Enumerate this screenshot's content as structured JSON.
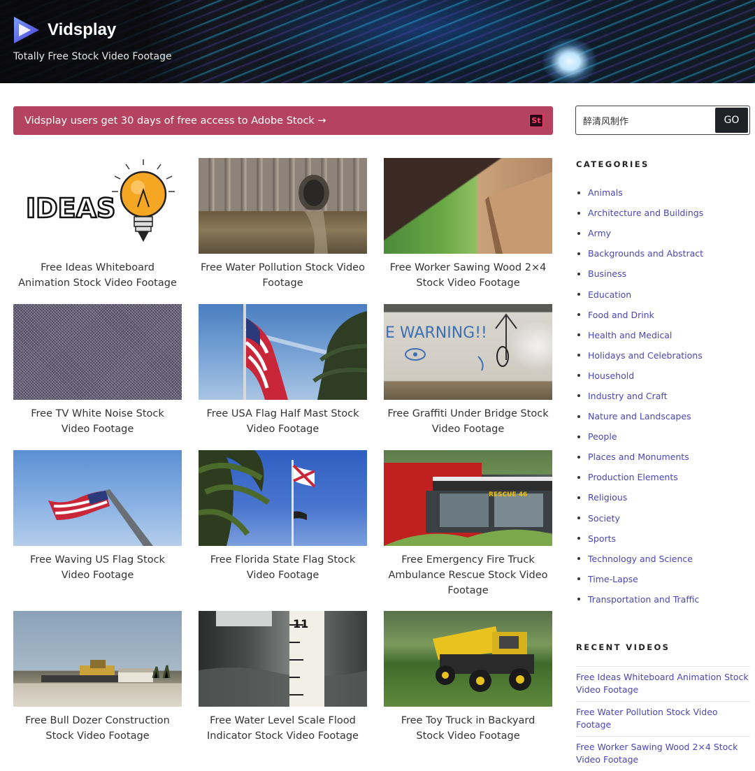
{
  "header": {
    "logo_text": "Vidsplay",
    "tagline": "Totally Free Stock Video Footage"
  },
  "promo": {
    "text": "Vidsplay users get 30 days of free access to Adobe Stock →",
    "badge": "St"
  },
  "videos": [
    {
      "title": "Free Ideas Whiteboard Animation Stock Video Footage",
      "thumb_text": "IDEAS"
    },
    {
      "title": "Free Water Pollution Stock Video Footage"
    },
    {
      "title": "Free Worker Sawing Wood 2×4 Stock Video Footage"
    },
    {
      "title": "Free TV White Noise Stock Video Footage"
    },
    {
      "title": "Free USA Flag Half Mast Stock Video Footage"
    },
    {
      "title": "Free Graffiti Under Bridge Stock Video Footage",
      "thumb_text": "E WARNING!!"
    },
    {
      "title": "Free Waving US Flag Stock Video Footage"
    },
    {
      "title": "Free Florida State Flag Stock Video Footage"
    },
    {
      "title": "Free Emergency Fire Truck Ambulance Rescue Stock Video Footage",
      "thumb_text": "RESCUE 46"
    },
    {
      "title": "Free Bull Dozer Construction Stock Video Footage"
    },
    {
      "title": "Free Water Level Scale Flood Indicator Stock Video Footage",
      "thumb_text": "11"
    },
    {
      "title": "Free Toy Truck in Backyard Stock Video Footage"
    }
  ],
  "search": {
    "value": "醉清风制作",
    "button_label": "GO"
  },
  "sidebar": {
    "categories_heading": "CATEGORIES",
    "categories": [
      "Animals",
      "Architecture and Buildings",
      "Army",
      "Backgrounds and Abstract",
      "Business",
      "Education",
      "Food and Drink",
      "Health and Medical",
      "Holidays and Celebrations",
      "Household",
      "Industry and Craft",
      "Nature and Landscapes",
      "People",
      "Places and Monuments",
      "Production Elements",
      "Religious",
      "Society",
      "Sports",
      "Technology and Science",
      "Time-Lapse",
      "Transportation and Traffic"
    ],
    "recent_heading": "RECENT VIDEOS",
    "recent": [
      "Free Ideas Whiteboard Animation Stock Video Footage",
      "Free Water Pollution Stock Video Footage",
      "Free Worker Sawing Wood 2×4 Stock Video Footage"
    ]
  },
  "colors": {
    "promo_bg": "#b5435f",
    "link": "#4a47b5",
    "button_bg": "#1f2226"
  }
}
